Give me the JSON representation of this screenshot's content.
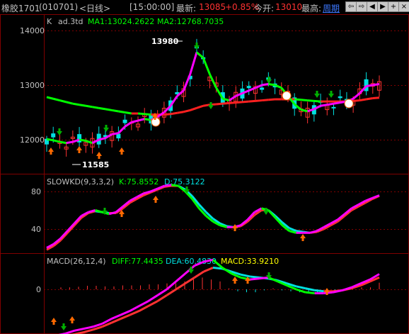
{
  "titlebar": {
    "symbol": "橡胶1701",
    "code": "(010701)",
    "period": "<日线>",
    "time": "[15:00:00]",
    "last_label": "最新:",
    "last_value": "13085",
    "change_pct": "+0.85%",
    "open_label": "今开:",
    "open_value": "13010",
    "high_label": "最高:",
    "high_value": "周期",
    "buttons": [
      "back-icon",
      "forward-icon",
      "left-icon",
      "right-icon",
      "add-icon",
      "close-icon"
    ]
  },
  "colors": {
    "background": "#000000",
    "frame": "#800000",
    "up": "#ff3232",
    "down": "#00e0e0",
    "ma1": "#ff00ff",
    "ma2_up": "#ff2020",
    "ma2_down": "#00ff00",
    "label": "#c0c0c0",
    "value_green": "#00ff00",
    "value_cyan": "#00e0e0",
    "value_yellow": "#ffff00"
  },
  "main_panel": {
    "prefix": "K",
    "indicator": "ad.3td",
    "ma1_text": "MA1:13024.2622",
    "ma2_text": "MA2:12768.7035",
    "high_mark": "13980",
    "low_mark": "11585",
    "y_ticks": [
      "14000",
      "13000",
      "12000"
    ]
  },
  "kd_panel": {
    "name": "SLOWKD(9,3,3,2)",
    "k_text": "K:75.8552",
    "d_text": "D:75.3122",
    "y_ticks": [
      "80",
      "40"
    ]
  },
  "macd_panel": {
    "name": "MACD(26,12,4)",
    "diff_text": "DIFF:77.4435",
    "dea_text": "DEA:60.4830",
    "macd_text": "MACD:33.9210",
    "y_ticks": [
      "0"
    ]
  },
  "chart_data": [
    {
      "type": "candlestick",
      "title": "K ad.3td",
      "ylim": [
        11500,
        14200
      ],
      "series": [
        {
          "name": "MA1",
          "values": [
            12010,
            11990,
            11960,
            11940,
            11960,
            12000,
            11980,
            11940,
            12000,
            12030,
            12100,
            12120,
            12240,
            12320,
            12350,
            12380,
            12360,
            12420,
            12500,
            12620,
            12800,
            12900,
            13200,
            13600,
            13500,
            13200,
            12950,
            12750,
            12720,
            12800,
            12850,
            12900,
            12950,
            13000,
            13020,
            13000,
            12950,
            12800,
            12650,
            12550,
            12520,
            12560,
            12620,
            12640,
            12660,
            12680,
            12700,
            12750,
            12850,
            12980,
            13000,
            13020
          ]
        },
        {
          "name": "MA2",
          "values": [
            12780,
            12750,
            12720,
            12690,
            12660,
            12640,
            12620,
            12600,
            12580,
            12560,
            12540,
            12520,
            12500,
            12480,
            12480,
            12470,
            12460,
            12460,
            12460,
            12470,
            12490,
            12510,
            12540,
            12580,
            12620,
            12640,
            12650,
            12660,
            12670,
            12680,
            12690,
            12700,
            12710,
            12720,
            12730,
            12740,
            12740,
            12740,
            12740,
            12730,
            12720,
            12710,
            12700,
            12700,
            12700,
            12700,
            12700,
            12710,
            12720,
            12740,
            12760,
            12770
          ]
        }
      ],
      "annotations": [
        "13980",
        "11585"
      ]
    },
    {
      "type": "line",
      "title": "SLOWKD(9,3,3,2)",
      "ylim": [
        15,
        90
      ],
      "series": [
        {
          "name": "K",
          "values": [
            20,
            24,
            30,
            38,
            46,
            54,
            58,
            60,
            58,
            56,
            58,
            64,
            70,
            74,
            78,
            80,
            83,
            86,
            87,
            86,
            80,
            72,
            62,
            54,
            48,
            44,
            42,
            42,
            44,
            50,
            58,
            62,
            60,
            52,
            44,
            38,
            36,
            36,
            36,
            38,
            42,
            46,
            50,
            56,
            62,
            66,
            70,
            73,
            75.8552
          ]
        },
        {
          "name": "D",
          "values": [
            18,
            22,
            28,
            36,
            44,
            52,
            57,
            59,
            58,
            57,
            57,
            62,
            68,
            72,
            76,
            79,
            82,
            85,
            86,
            86,
            82,
            75,
            66,
            58,
            51,
            46,
            43,
            42,
            43,
            48,
            55,
            60,
            60,
            54,
            47,
            41,
            38,
            37,
            36,
            37,
            40,
            44,
            48,
            54,
            60,
            64,
            68,
            72,
            75.3122
          ]
        }
      ]
    },
    {
      "type": "line",
      "title": "MACD(26,12,4)",
      "ylim": [
        -300,
        180
      ],
      "series": [
        {
          "name": "DIFF",
          "values": [
            -240,
            -235,
            -225,
            -210,
            -200,
            -190,
            -175,
            -150,
            -130,
            -110,
            -85,
            -60,
            -30,
            0,
            40,
            80,
            120,
            140,
            150,
            110,
            80,
            60,
            50,
            55,
            60,
            40,
            20,
            0,
            -15,
            -20,
            -20,
            -15,
            -5,
            10,
            30,
            50,
            77.4435
          ]
        },
        {
          "name": "DEA",
          "values": [
            -250,
            -245,
            -238,
            -228,
            -218,
            -205,
            -190,
            -170,
            -150,
            -130,
            -110,
            -85,
            -60,
            -30,
            0,
            30,
            60,
            90,
            110,
            105,
            90,
            75,
            65,
            60,
            55,
            45,
            30,
            15,
            5,
            -5,
            -10,
            -10,
            -5,
            5,
            20,
            40,
            60.483
          ]
        },
        {
          "name": "MACD",
          "values": [
            10,
            10,
            13,
            18,
            18,
            15,
            15,
            20,
            20,
            20,
            25,
            25,
            30,
            30,
            40,
            50,
            60,
            50,
            40,
            5,
            -10,
            -15,
            -15,
            -5,
            5,
            -5,
            -10,
            -15,
            -20,
            -15,
            -10,
            -5,
            0,
            5,
            10,
            10,
            33.921
          ]
        }
      ]
    }
  ]
}
